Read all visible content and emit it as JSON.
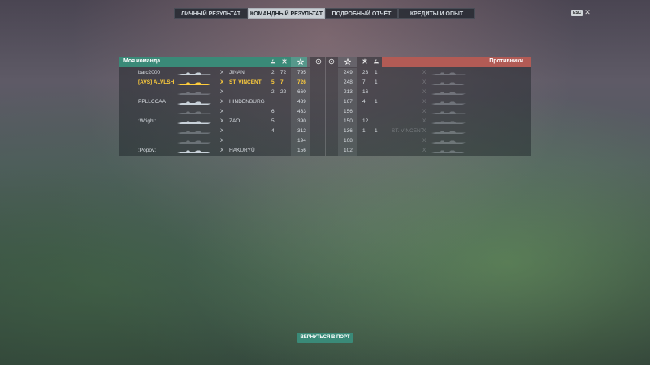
{
  "tabs": [
    {
      "label": "ЛИЧНЫЙ РЕЗУЛЬТАТ",
      "active": false
    },
    {
      "label": "КОМАНДНЫЙ РЕЗУЛЬТАТ",
      "active": true
    },
    {
      "label": "ПОДРОБНЫЙ ОТЧЁТ",
      "active": false
    },
    {
      "label": "КРЕДИТЫ И ОПЫТ",
      "active": false
    }
  ],
  "esc": {
    "key": "ESC",
    "close_glyph": "✕"
  },
  "header": {
    "my_team": "Моя команда",
    "enemy_team": "Противники"
  },
  "icons": {
    "kills": "ship-kill-icon",
    "planes": "plane-kill-icon",
    "xp": "star-icon",
    "spotted": "spotting-icon"
  },
  "my_team": [
    {
      "player": "barc2000",
      "tier": "X",
      "ship": "JINAN",
      "kills": "2",
      "planes": "72",
      "xp": "795",
      "faded": false,
      "hl": false
    },
    {
      "player": "[AVS] ALVLSH",
      "tier": "X",
      "ship": "ST. VINCENT",
      "kills": "5",
      "planes": "7",
      "xp": "726",
      "faded": false,
      "hl": true
    },
    {
      "player": "",
      "tier": "X",
      "ship": "",
      "kills": "2",
      "planes": "22",
      "xp": "660",
      "faded": true,
      "hl": false
    },
    {
      "player": "PPLLCCAA",
      "tier": "X",
      "ship": "HINDENBURG",
      "kills": "",
      "planes": "",
      "xp": "439",
      "faded": false,
      "hl": false
    },
    {
      "player": "",
      "tier": "X",
      "ship": "",
      "kills": "6",
      "planes": "",
      "xp": "433",
      "faded": true,
      "hl": false
    },
    {
      "player": ":Wright:",
      "tier": "X",
      "ship": "ZAŌ",
      "kills": "5",
      "planes": "",
      "xp": "390",
      "faded": false,
      "hl": false
    },
    {
      "player": "",
      "tier": "X",
      "ship": "",
      "kills": "4",
      "planes": "",
      "xp": "312",
      "faded": true,
      "hl": false
    },
    {
      "player": "",
      "tier": "X",
      "ship": "",
      "kills": "",
      "planes": "",
      "xp": "194",
      "faded": true,
      "hl": false
    },
    {
      "player": ":Popov:",
      "tier": "X",
      "ship": "HAKURYŪ",
      "kills": "",
      "planes": "",
      "xp": "156",
      "faded": false,
      "hl": false
    }
  ],
  "enemy_team": [
    {
      "xp": "249",
      "kills": "23",
      "planes": "1",
      "tier": "X",
      "ship": "",
      "player": ""
    },
    {
      "xp": "248",
      "kills": "7",
      "planes": "1",
      "tier": "X",
      "ship": "",
      "player": ""
    },
    {
      "xp": "213",
      "kills": "16",
      "planes": "",
      "tier": "X",
      "ship": "",
      "player": ""
    },
    {
      "xp": "167",
      "kills": "4",
      "planes": "1",
      "tier": "X",
      "ship": "",
      "player": ""
    },
    {
      "xp": "156",
      "kills": "",
      "planes": "",
      "tier": "X",
      "ship": "",
      "player": ""
    },
    {
      "xp": "150",
      "kills": "12",
      "planes": "",
      "tier": "X",
      "ship": "",
      "player": ""
    },
    {
      "xp": "136",
      "kills": "1",
      "planes": "1",
      "tier": "X",
      "ship": "ST. VINCENT",
      "player": ""
    },
    {
      "xp": "108",
      "kills": "",
      "planes": "",
      "tier": "X",
      "ship": "",
      "player": ""
    },
    {
      "xp": "102",
      "kills": "",
      "planes": "",
      "tier": "X",
      "ship": "",
      "player": ""
    }
  ],
  "footer": {
    "back_label": "ВЕРНУТЬСЯ В ПОРТ"
  },
  "colors": {
    "my_team": "#3a8a78",
    "enemy_team": "#b25b55",
    "highlight": "#ffcd3c"
  }
}
